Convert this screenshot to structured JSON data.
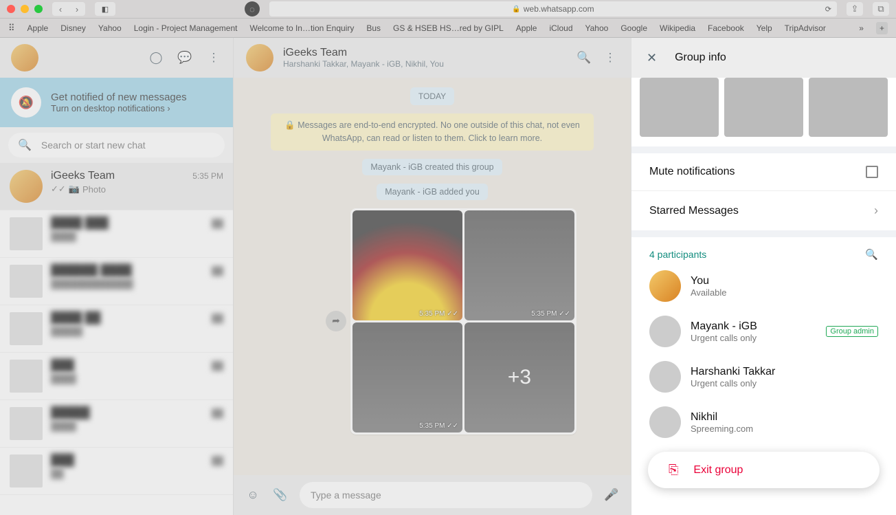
{
  "browser": {
    "url_display": "web.whatsapp.com",
    "bookmarks": [
      "Apple",
      "Disney",
      "Yahoo",
      "Login - Project Management",
      "Welcome to In…tion Enquiry",
      "Bus",
      "GS & HSEB HS…red by GIPL",
      "Apple",
      "iCloud",
      "Yahoo",
      "Google",
      "Wikipedia",
      "Facebook",
      "Yelp",
      "TripAdvisor"
    ]
  },
  "sidebar": {
    "notify_title": "Get notified of new messages",
    "notify_sub": "Turn on desktop notifications ›",
    "search_placeholder": "Search or start new chat",
    "active": {
      "name": "iGeeks Team",
      "time": "5:35 PM",
      "preview": "Photo"
    }
  },
  "chat": {
    "title": "iGeeks Team",
    "subtitle": "Harshanki Takkar, Mayank - iGB, Nikhil, You",
    "date_pill": "TODAY",
    "encryption_notice": "Messages are end-to-end encrypted. No one outside of this chat, not even WhatsApp, can read or listen to them. Click to learn more.",
    "sys_created": "Mayank - iGB created this group",
    "sys_added": "Mayank - iGB added you",
    "image_time": "5:35 PM ✓✓",
    "more_images": "+3",
    "composer_placeholder": "Type a message"
  },
  "panel": {
    "title": "Group info",
    "mute": "Mute notifications",
    "starred": "Starred Messages",
    "participants_label": "4 participants",
    "members": [
      {
        "name": "You",
        "sub": "Available",
        "admin": false
      },
      {
        "name": "Mayank - iGB",
        "sub": "Urgent calls only",
        "admin": true
      },
      {
        "name": "Harshanki Takkar",
        "sub": "Urgent calls only",
        "admin": false
      },
      {
        "name": "Nikhil",
        "sub": "Spreeming.com",
        "admin": false
      }
    ],
    "admin_badge": "Group admin",
    "exit": "Exit group"
  }
}
